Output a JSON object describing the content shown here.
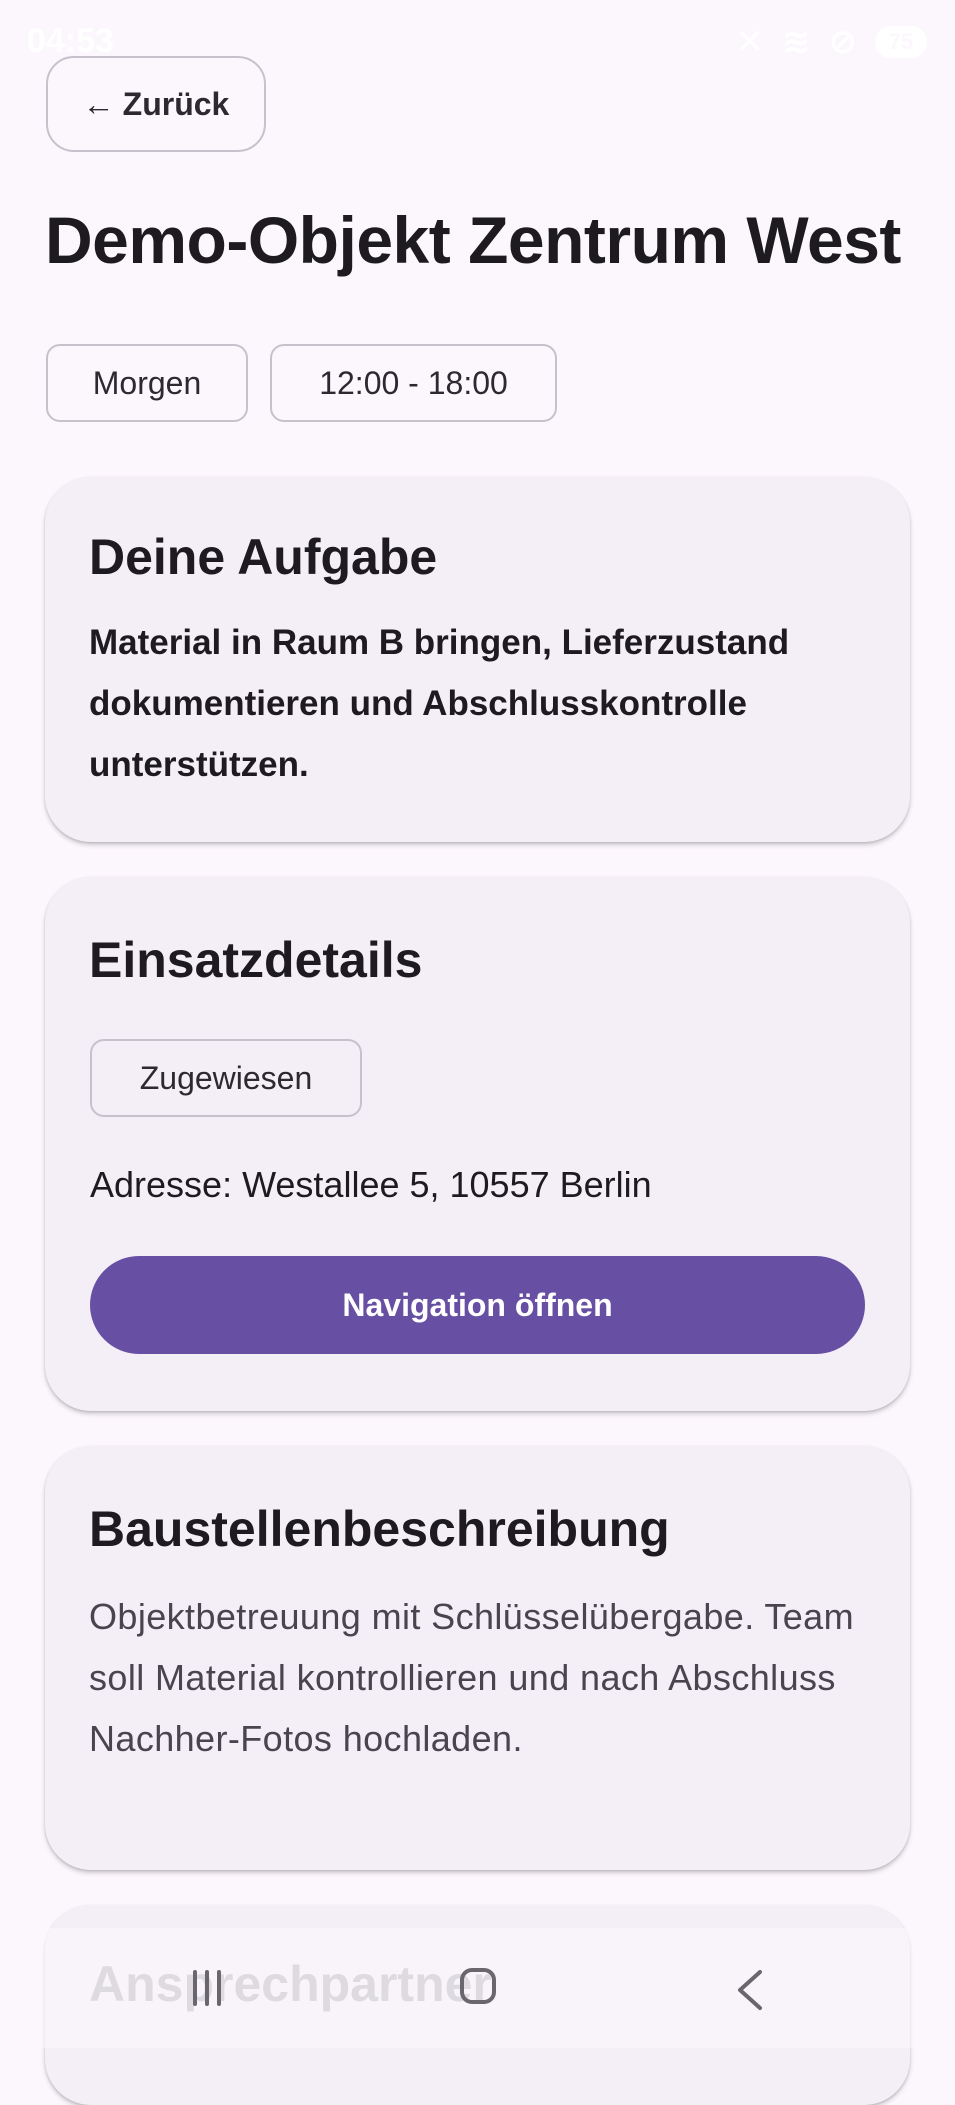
{
  "status_bar": {
    "time": "04:53",
    "battery": "75"
  },
  "header": {
    "back_label": "Zurück",
    "back_arrow": "←",
    "title": "Demo-Objekt Zentrum West"
  },
  "schedule": {
    "day": "Morgen",
    "time_range": "12:00 - 18:00"
  },
  "task_card": {
    "heading": "Deine Aufgabe",
    "text": "Material in Raum B bringen, Lieferzustand dokumentieren und Abschlusskontrolle unterstützen."
  },
  "details_card": {
    "heading": "Einsatzdetails",
    "status": "Zugewiesen",
    "address": "Adresse: Westallee 5, 10557 Berlin",
    "navigation_button": "Navigation öffnen"
  },
  "description_card": {
    "heading": "Baustellenbeschreibung",
    "text": "Objektbetreuung mit Schlüsselübergabe. Team soll Material kontrollieren und nach Abschluss Nachher-Fotos hochladen."
  },
  "contact_card": {
    "heading": "Ansprechpartner"
  },
  "system_nav": {
    "icons": [
      "recents-icon",
      "home-icon",
      "back-icon"
    ]
  },
  "colors": {
    "accent": "#6750a4",
    "background": "#fcf7fd",
    "card": "#f4eff6"
  }
}
